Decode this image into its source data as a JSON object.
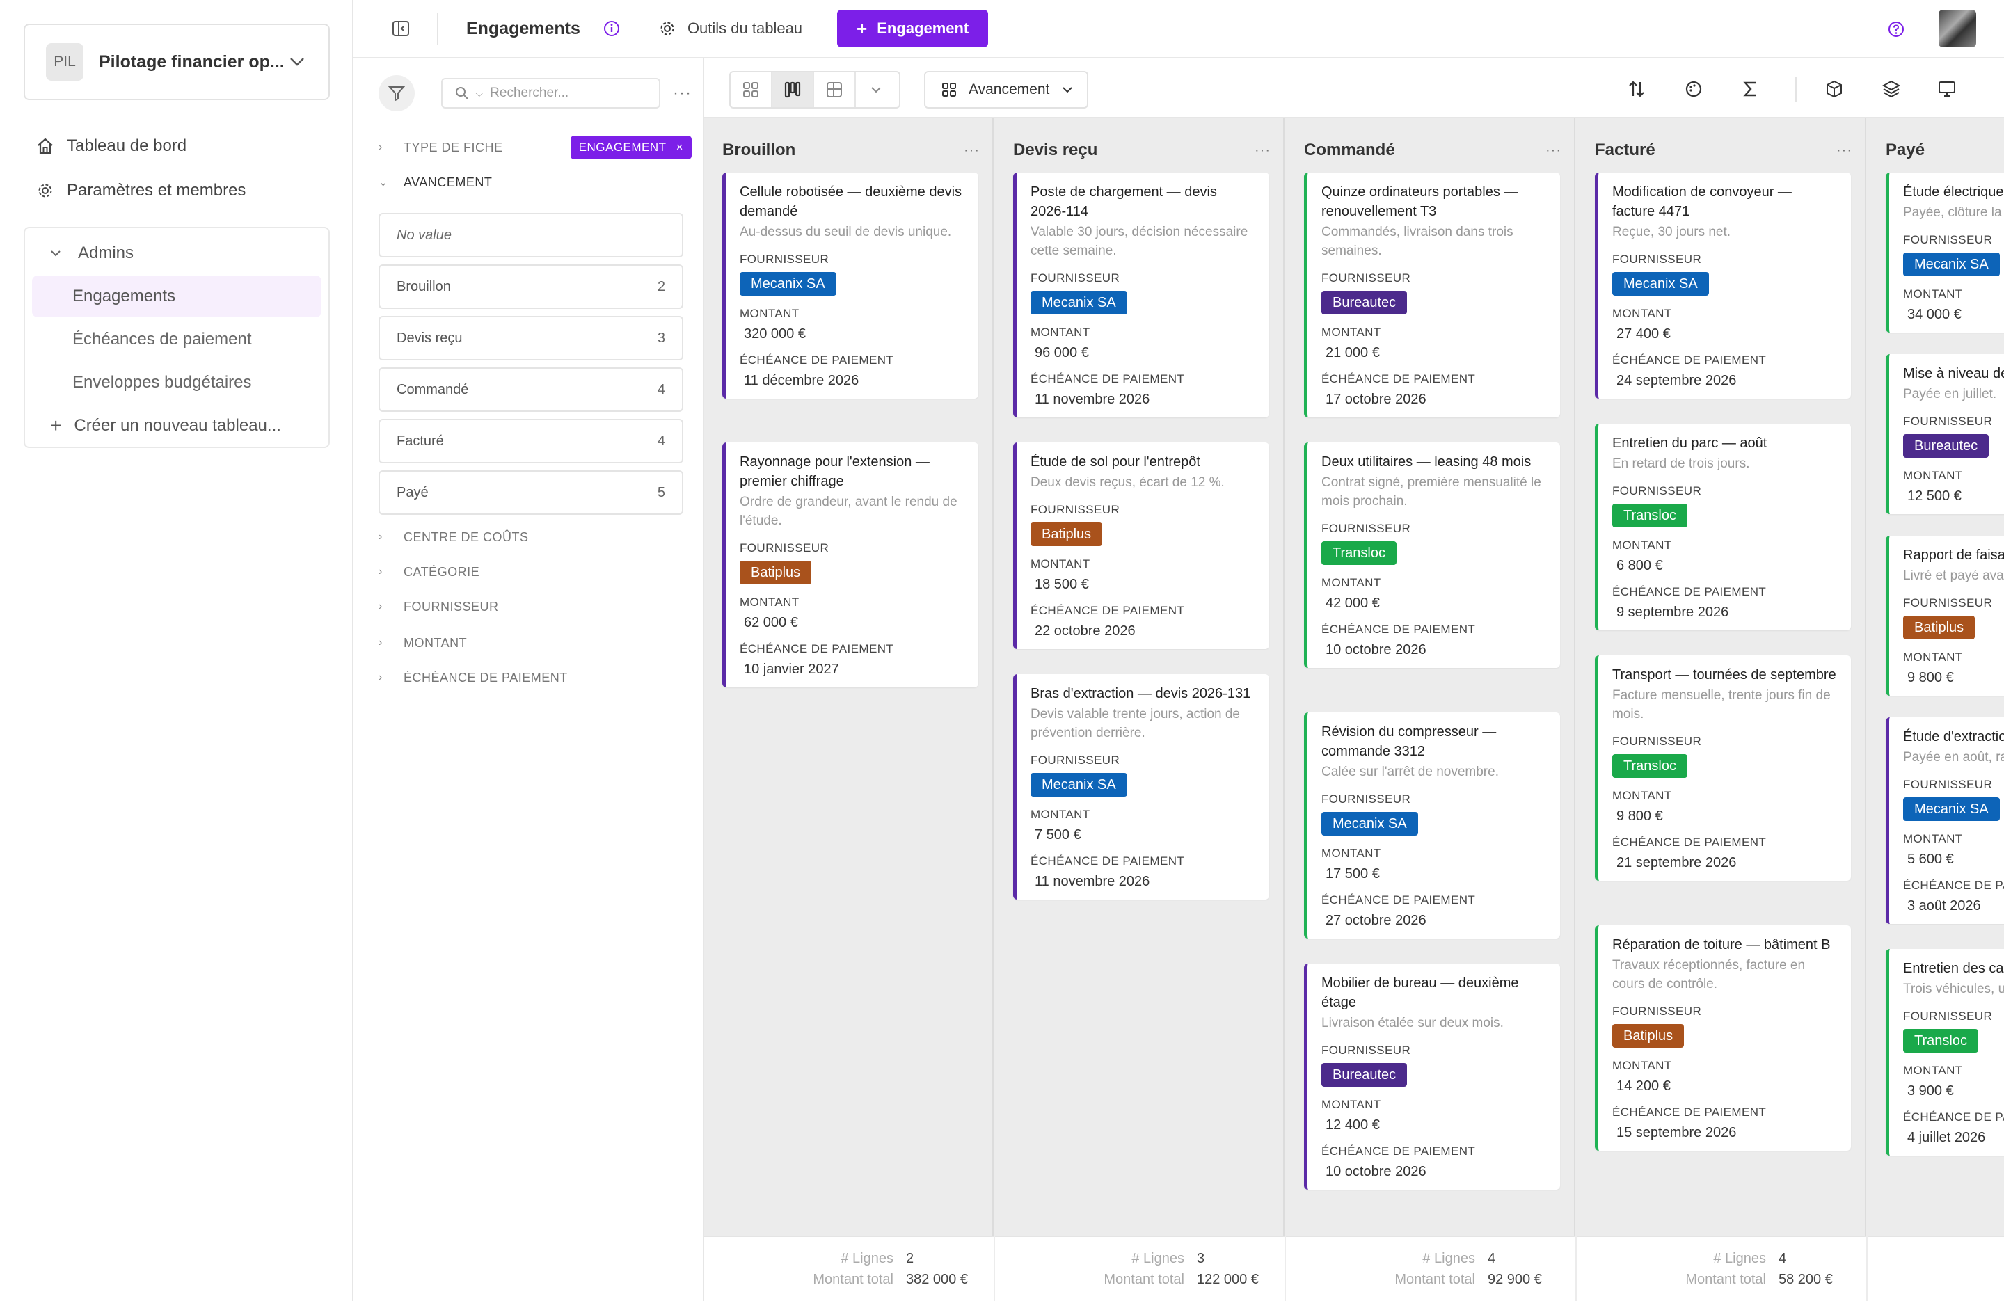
{
  "sidebar": {
    "workspace": {
      "initials": "PIL",
      "name": "Pilotage financier op..."
    },
    "nav": [
      {
        "label": "Tableau de bord",
        "icon": "home-icon"
      },
      {
        "label": "Paramètres et membres",
        "icon": "gear-icon"
      }
    ],
    "group": {
      "label": "Admins",
      "items": [
        "Engagements",
        "Échéances de paiement",
        "Enveloppes budgétaires"
      ],
      "create_label": "Créer un nouveau tableau..."
    }
  },
  "topbar": {
    "title": "Engagements",
    "tools_label": "Outils du tableau",
    "new_button": "Engagement"
  },
  "filters": {
    "search_placeholder": "Rechercher...",
    "sections": {
      "type": "TYPE DE FICHE",
      "avancement": "AVANCEMENT",
      "centre": "CENTRE DE COÛTS",
      "categorie": "CATÉGORIE",
      "fournisseur": "FOURNISSEUR",
      "montant": "MONTANT",
      "echeance": "ÉCHÉANCE DE PAIEMENT"
    },
    "type_chip": "ENGAGEMENT",
    "options": [
      {
        "label": "No value",
        "count": ""
      },
      {
        "label": "Brouillon",
        "count": "2"
      },
      {
        "label": "Devis reçu",
        "count": "3"
      },
      {
        "label": "Commandé",
        "count": "4"
      },
      {
        "label": "Facturé",
        "count": "4"
      },
      {
        "label": "Payé",
        "count": "5"
      }
    ]
  },
  "toolbar": {
    "group_by": "Avancement"
  },
  "colors": {
    "accent": "#7c1fe8",
    "Mecanix SA": "#0d64b8",
    "Batiplus": "#a9521c",
    "Bureautec": "#4c2a8c",
    "Transloc": "#1aa94a"
  },
  "labels": {
    "fournisseur": "FOURNISSEUR",
    "montant": "MONTANT",
    "echeance": "ÉCHÉANCE DE PAIEMENT",
    "lignes": "# Lignes",
    "total": "Montant total"
  },
  "columns": [
    {
      "title": "Brouillon",
      "lignes": "2",
      "total": "382 000 €",
      "cards": [
        {
          "title": "Cellule robotisée — deuxième devis demandé",
          "desc": "Au-dessus du seuil de devis unique.",
          "fournisseur": "Mecanix SA",
          "montant": "320 000 €",
          "echeance": "11 décembre 2026",
          "stripe": "purple"
        },
        {
          "title": "Rayonnage pour l'extension — premier chiffrage",
          "desc": "Ordre de grandeur, avant le rendu de l'étude.",
          "fournisseur": "Batiplus",
          "montant": "62 000 €",
          "echeance": "10 janvier 2027",
          "stripe": "purple"
        }
      ]
    },
    {
      "title": "Devis reçu",
      "lignes": "3",
      "total": "122 000 €",
      "cards": [
        {
          "title": "Poste de chargement — devis 2026-114",
          "desc": "Valable 30 jours, décision nécessaire cette semaine.",
          "fournisseur": "Mecanix SA",
          "montant": "96 000 €",
          "echeance": "11 novembre 2026",
          "stripe": "purple"
        },
        {
          "title": "Étude de sol pour l'entrepôt",
          "desc": "Deux devis reçus, écart de 12 %.",
          "fournisseur": "Batiplus",
          "montant": "18 500 €",
          "echeance": "22 octobre 2026",
          "stripe": "purple"
        },
        {
          "title": "Bras d'extraction — devis 2026-131",
          "desc": "Devis valable trente jours, action de prévention derrière.",
          "fournisseur": "Mecanix SA",
          "montant": "7 500 €",
          "echeance": "11 novembre 2026",
          "stripe": "purple"
        }
      ]
    },
    {
      "title": "Commandé",
      "lignes": "4",
      "total": "92 900 €",
      "cards": [
        {
          "title": "Quinze ordinateurs portables — renouvellement T3",
          "desc": "Commandés, livraison dans trois semaines.",
          "fournisseur": "Bureautec",
          "montant": "21 000 €",
          "echeance": "17 octobre 2026",
          "stripe": "green"
        },
        {
          "title": "Deux utilitaires — leasing 48 mois",
          "desc": "Contrat signé, première mensualité le mois prochain.",
          "fournisseur": "Transloc",
          "montant": "42 000 €",
          "echeance": "10 octobre 2026",
          "stripe": "green"
        },
        {
          "title": "Révision du compresseur — commande 3312",
          "desc": "Calée sur l'arrêt de novembre.",
          "fournisseur": "Mecanix SA",
          "montant": "17 500 €",
          "echeance": "27 octobre 2026",
          "stripe": "green"
        },
        {
          "title": "Mobilier de bureau — deuxième étage",
          "desc": "Livraison étalée sur deux mois.",
          "fournisseur": "Bureautec",
          "montant": "12 400 €",
          "echeance": "10 octobre 2026",
          "stripe": "purple"
        }
      ]
    },
    {
      "title": "Facturé",
      "lignes": "4",
      "total": "58 200 €",
      "cards": [
        {
          "title": "Modification de convoyeur — facture 4471",
          "desc": "Reçue, 30 jours net.",
          "fournisseur": "Mecanix SA",
          "montant": "27 400 €",
          "echeance": "24 septembre 2026",
          "stripe": "purple"
        },
        {
          "title": "Entretien du parc — août",
          "desc": "En retard de trois jours.",
          "fournisseur": "Transloc",
          "montant": "6 800 €",
          "echeance": "9 septembre 2026",
          "stripe": "green"
        },
        {
          "title": "Transport — tournées de septembre",
          "desc": "Facture mensuelle, trente jours fin de mois.",
          "fournisseur": "Transloc",
          "montant": "9 800 €",
          "echeance": "21 septembre 2026",
          "stripe": "green"
        },
        {
          "title": "Réparation de toiture — bâtiment B",
          "desc": "Travaux réceptionnés, facture en cours de contrôle.",
          "fournisseur": "Batiplus",
          "montant": "14 200 €",
          "echeance": "15 septembre 2026",
          "stripe": "green"
        }
      ]
    },
    {
      "title": "Payé",
      "lignes": "",
      "total": "",
      "cards": [
        {
          "title": "Étude électrique",
          "desc": "Payée, clôture la",
          "fournisseur": "Mecanix SA",
          "montant": "34 000 €",
          "echeance": "",
          "stripe": "green"
        },
        {
          "title": "Mise à niveau de",
          "desc": "Payée en juillet.",
          "fournisseur": "Bureautec",
          "montant": "12 500 €",
          "echeance": "",
          "stripe": "green"
        },
        {
          "title": "Rapport de faisa",
          "desc": "Livré et payé ava",
          "fournisseur": "Batiplus",
          "montant": "9 800 €",
          "echeance": "",
          "stripe": "green"
        },
        {
          "title": "Étude d'extractio",
          "desc": "Payée en août, ra",
          "fournisseur": "Mecanix SA",
          "montant": "5 600 €",
          "echeance": "3 août 2026",
          "stripe": "purple",
          "echeance_label": "ÉCHÉANCE DE PA"
        },
        {
          "title": "Entretien des ca premier semestr",
          "desc": "Trois véhicules, u",
          "fournisseur": "Transloc",
          "montant": "3 900 €",
          "echeance": "4 juillet 2026",
          "stripe": "green",
          "echeance_label": "ÉCHÉANCE DE PA"
        }
      ]
    }
  ]
}
